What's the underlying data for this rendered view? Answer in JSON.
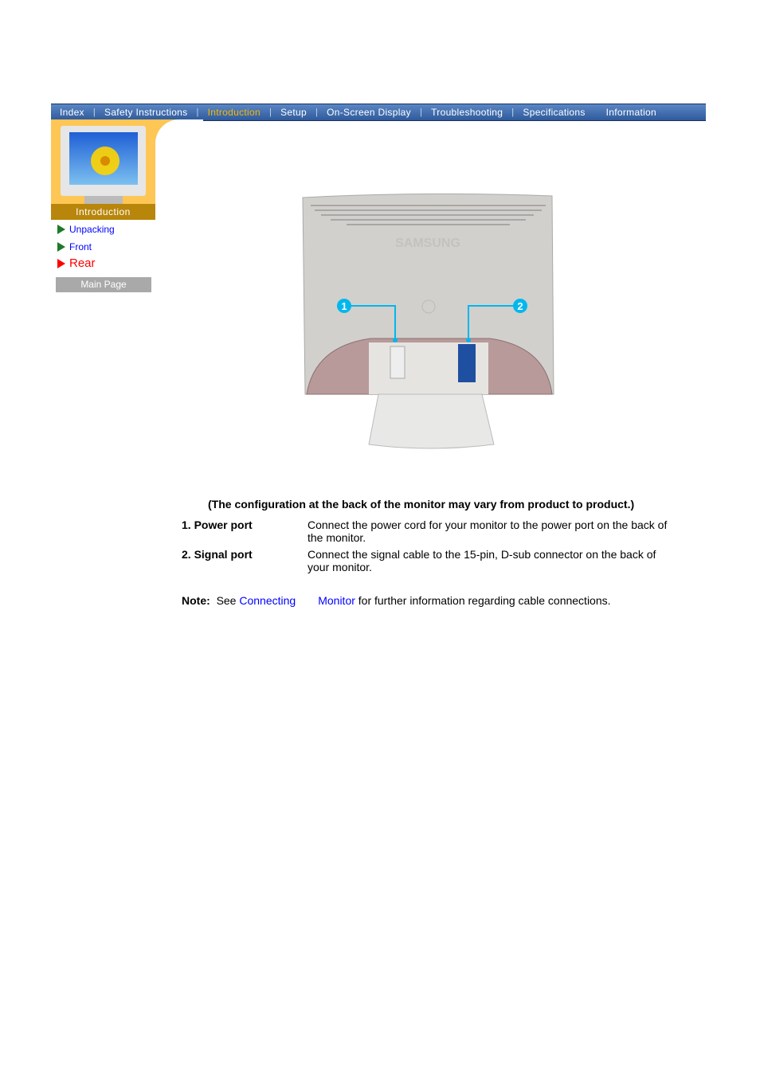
{
  "nav": {
    "items": [
      {
        "label": "Index"
      },
      {
        "label": "Safety Instructions"
      },
      {
        "label": "Introduction",
        "active": true
      },
      {
        "label": "Setup"
      },
      {
        "label": "On-Screen Display"
      },
      {
        "label": "Troubleshooting"
      },
      {
        "label": "Specifications"
      },
      {
        "label": "Information"
      }
    ]
  },
  "sidebar": {
    "section_label": "Introduction",
    "items": [
      {
        "label": "Unpacking"
      },
      {
        "label": "Front"
      },
      {
        "label": "Rear",
        "current": true
      }
    ],
    "main_page": "Main Page"
  },
  "image": {
    "brand": "SAMSUNG",
    "callout_1": "1",
    "callout_2": "2"
  },
  "content": {
    "caption": "(The configuration at the back of the monitor may vary from product to product.)",
    "ports": [
      {
        "name": "1. Power port",
        "desc": "Connect the power cord for your monitor to the power port on the back of the monitor."
      },
      {
        "name": "2. Signal port",
        "desc": "Connect the signal cable to the 15-pin, D-sub connector on the back of your monitor."
      }
    ],
    "note_label": "Note:",
    "note_pre": "See",
    "link1": "Connecting",
    "link2": "Monitor",
    "note_post": "for further information regarding cable connections."
  },
  "colors": {
    "nav": "#3a67ab",
    "active": "#f5b800",
    "panel": "#fec655",
    "panel_label": "#b8860b",
    "callout": "#00b7ee"
  }
}
